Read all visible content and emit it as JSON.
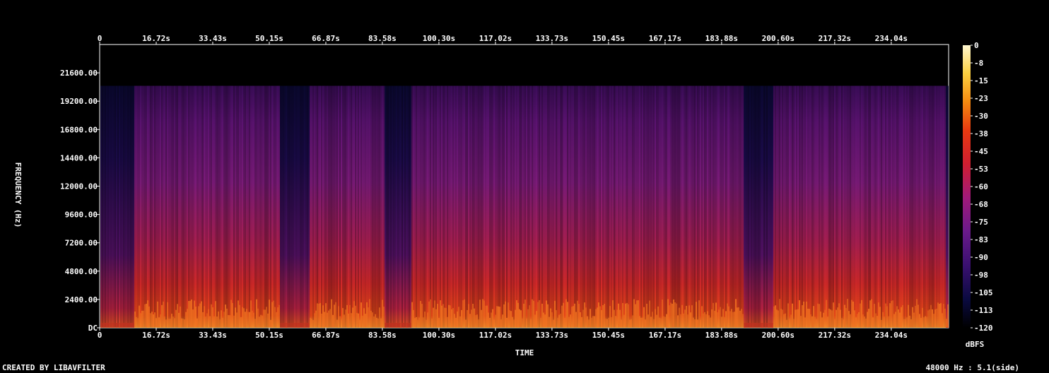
{
  "chart_data": {
    "type": "heatmap",
    "xlabel": "TIME",
    "ylabel": "FREQUENCY (Hz)",
    "x_ticks": [
      "0",
      "16.72s",
      "33.43s",
      "50.15s",
      "66.87s",
      "83.58s",
      "100.30s",
      "117.02s",
      "133.73s",
      "150.45s",
      "167.17s",
      "183.88s",
      "200.60s",
      "217.32s",
      "234.04s"
    ],
    "x_tick_values_s": [
      0,
      16.72,
      33.43,
      50.15,
      66.87,
      83.58,
      100.3,
      117.02,
      133.73,
      150.45,
      167.17,
      183.88,
      200.6,
      217.32,
      234.04
    ],
    "xlim_s": [
      0,
      251
    ],
    "y_ticks": [
      "DC",
      "2400.00",
      "4800.00",
      "7200.00",
      "9600.00",
      "12000.00",
      "14400.00",
      "16800.00",
      "19200.00",
      "21600.00"
    ],
    "y_tick_values_hz": [
      0,
      2400,
      4800,
      7200,
      9600,
      12000,
      14400,
      16800,
      19200,
      21600
    ],
    "ylim_hz": [
      0,
      24000
    ],
    "content_cutoff_hz": 20500,
    "colorbar": {
      "unit": "dBFS",
      "ticks": [
        "0",
        "-8",
        "-15",
        "-23",
        "-30",
        "-38",
        "-45",
        "-53",
        "-60",
        "-68",
        "-75",
        "-83",
        "-90",
        "-98",
        "-105",
        "-113",
        "-120"
      ],
      "range": [
        -120,
        0
      ],
      "colors": [
        "#000000",
        "#0a0a40",
        "#3a1070",
        "#6a1a8a",
        "#a01a7a",
        "#d01e30",
        "#e83a10",
        "#f58a10",
        "#fcd040",
        "#fff8d0"
      ]
    },
    "loud_segments_s": [
      [
        10,
        53
      ],
      [
        62,
        250
      ]
    ],
    "quiet_dips_s": [
      [
        0,
        10
      ],
      [
        53,
        62
      ],
      [
        84,
        92
      ],
      [
        190,
        199
      ]
    ],
    "notes": []
  },
  "footer": {
    "left": "CREATED BY LIBAVFILTER",
    "right": "48000 Hz : 5.1(side)"
  }
}
